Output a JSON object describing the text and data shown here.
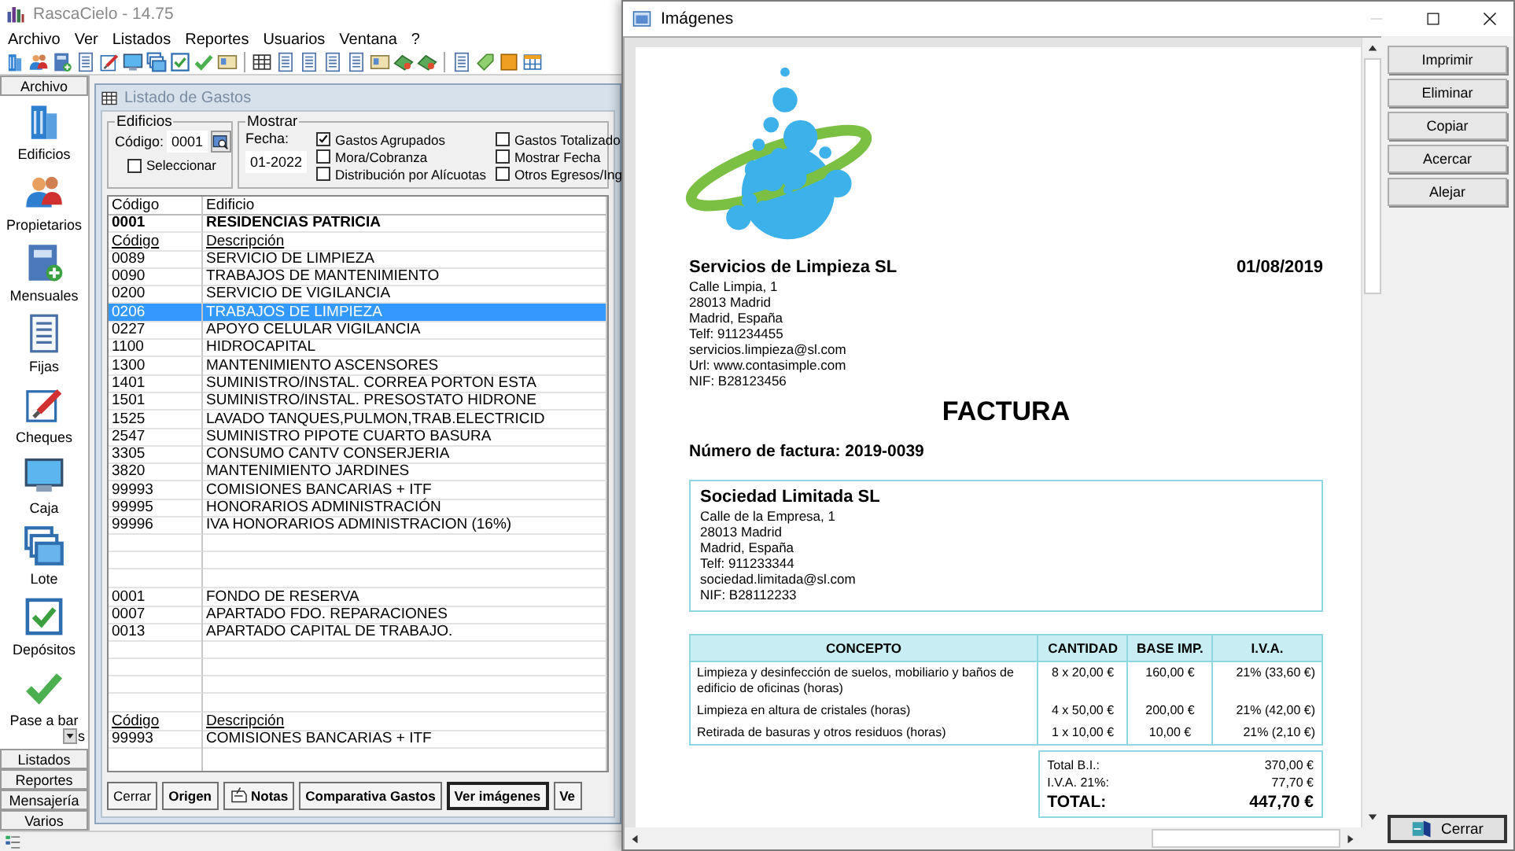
{
  "app_window": {
    "title": "RascaCielo - 14.75"
  },
  "menu": [
    "Archivo",
    "Ver",
    "Listados",
    "Reportes",
    "Usuarios",
    "Ventana",
    "?"
  ],
  "sidebar": {
    "header": "Archivo",
    "items": [
      {
        "label": "Edificios"
      },
      {
        "label": "Propietarios"
      },
      {
        "label": "Mensuales"
      },
      {
        "label": "Fijas"
      },
      {
        "label": "Cheques"
      },
      {
        "label": "Caja"
      },
      {
        "label": "Lote"
      },
      {
        "label": "Depósitos"
      },
      {
        "label": "Pase a bar",
        "dropdown": true,
        "label_tail": "s"
      }
    ],
    "sections": [
      "Listados",
      "Reportes",
      "Mensajería",
      "Varios"
    ]
  },
  "gastos_window": {
    "title": "Listado de Gastos",
    "edificios": {
      "legend": "Edificios",
      "codigo_label": "Código:",
      "codigo_value": "0001",
      "seleccionar": {
        "label": "Seleccionar",
        "checked": false
      }
    },
    "mostrar": {
      "legend": "Mostrar",
      "fecha_label": "Fecha:",
      "fecha_value": "01-2022",
      "options": [
        {
          "label": "Gastos Agrupados",
          "checked": true
        },
        {
          "label": "Mora/Cobranza",
          "checked": false
        },
        {
          "label": "Distribución por Alícuotas",
          "checked": false
        },
        {
          "label": "Gastos Totalizado",
          "checked": false
        },
        {
          "label": "Mostrar Fecha",
          "checked": false
        },
        {
          "label": "Otros Egresos/Ing",
          "checked": false
        }
      ]
    },
    "table": {
      "rows": [
        {
          "kind": "header",
          "cells": [
            "Código",
            "Edificio"
          ],
          "selected": false
        },
        {
          "kind": "building",
          "cells": [
            "0001",
            "RESIDENCIAS PATRICIA"
          ],
          "selected": false
        },
        {
          "kind": "subheader",
          "cells": [
            "Código",
            "Descripción"
          ],
          "selected": false
        },
        {
          "kind": "item",
          "cells": [
            "0089",
            "SERVICIO DE LIMPIEZA"
          ],
          "selected": false
        },
        {
          "kind": "item",
          "cells": [
            "0090",
            "TRABAJOS DE MANTENIMIENTO"
          ],
          "selected": false
        },
        {
          "kind": "item",
          "cells": [
            "0200",
            "SERVICIO DE VIGILANCIA"
          ],
          "selected": false
        },
        {
          "kind": "item",
          "cells": [
            "0206",
            "TRABAJOS DE LIMPIEZA"
          ],
          "selected": true
        },
        {
          "kind": "item",
          "cells": [
            "0227",
            "APOYO CELULAR VIGILANCIA"
          ],
          "selected": false
        },
        {
          "kind": "item",
          "cells": [
            "1100",
            "HIDROCAPITAL"
          ],
          "selected": false
        },
        {
          "kind": "item",
          "cells": [
            "1300",
            "MANTENIMIENTO ASCENSORES"
          ],
          "selected": false
        },
        {
          "kind": "item",
          "cells": [
            "1401",
            "SUMINISTRO/INSTAL. CORREA PORTON ESTA"
          ],
          "selected": false
        },
        {
          "kind": "item",
          "cells": [
            "1501",
            "SUMINISTRO/INSTAL. PRESOSTATO HIDRONE"
          ],
          "selected": false
        },
        {
          "kind": "item",
          "cells": [
            "1525",
            "LAVADO TANQUES,PULMON,TRAB.ELECTRICID"
          ],
          "selected": false
        },
        {
          "kind": "item",
          "cells": [
            "2547",
            "SUMINISTRO PIPOTE CUARTO BASURA"
          ],
          "selected": false
        },
        {
          "kind": "item",
          "cells": [
            "3305",
            "CONSUMO CANTV CONSERJERIA"
          ],
          "selected": false
        },
        {
          "kind": "item",
          "cells": [
            "3820",
            "MANTENIMIENTO JARDINES"
          ],
          "selected": false
        },
        {
          "kind": "item",
          "cells": [
            "99993",
            "COMISIONES BANCARIAS + ITF"
          ],
          "selected": false
        },
        {
          "kind": "item",
          "cells": [
            "99995",
            "HONORARIOS ADMINISTRACIÓN"
          ],
          "selected": false
        },
        {
          "kind": "item",
          "cells": [
            "99996",
            "IVA HONORARIOS ADMINISTRACION (16%)"
          ],
          "selected": false
        },
        {
          "kind": "blank"
        },
        {
          "kind": "blank"
        },
        {
          "kind": "blank"
        },
        {
          "kind": "item",
          "cells": [
            "0001",
            "FONDO DE RESERVA"
          ],
          "selected": false
        },
        {
          "kind": "item",
          "cells": [
            "0007",
            "APARTADO FDO. REPARACIONES"
          ],
          "selected": false
        },
        {
          "kind": "item",
          "cells": [
            "0013",
            "APARTADO  CAPITAL DE TRABAJO."
          ],
          "selected": false
        },
        {
          "kind": "blank"
        },
        {
          "kind": "blank"
        },
        {
          "kind": "blank"
        },
        {
          "kind": "blank"
        },
        {
          "kind": "subheader",
          "cells": [
            "Código",
            "Descripción"
          ],
          "selected": false
        },
        {
          "kind": "item",
          "cells": [
            "99993",
            "COMISIONES BANCARIAS + ITF"
          ],
          "selected": false
        }
      ]
    },
    "buttons": [
      {
        "label": "Cerrar",
        "kind": "plain",
        "focused": false
      },
      {
        "label": "Origen",
        "kind": "bold",
        "focused": false
      },
      {
        "label": "Notas",
        "kind": "note",
        "focused": false
      },
      {
        "label": "Comparativa Gastos",
        "kind": "bold",
        "focused": false
      },
      {
        "label": "Ver imágenes",
        "kind": "bold",
        "focused": true
      },
      {
        "label": "Ve",
        "kind": "bold",
        "focused": false
      }
    ]
  },
  "images_window": {
    "title": "Imágenes",
    "minimize_disabled": true,
    "buttons": [
      "Imprimir",
      "Eliminar",
      "Copiar",
      "Acercar",
      "Alejar"
    ],
    "close_button": "Cerrar",
    "invoice": {
      "issuer": {
        "name": "Servicios de Limpieza SL",
        "lines": [
          "Calle Limpia, 1",
          "28013 Madrid",
          "Madrid, España",
          "Telf:  911234455",
          "servicios.limpieza@sl.com",
          "Url: www.contasimple.com",
          "NIF: B28123456"
        ]
      },
      "date": "01/08/2019",
      "title": "FACTURA",
      "number": "Número de factura: 2019-0039",
      "client": {
        "name": "Sociedad Limitada SL",
        "lines": [
          "Calle de la Empresa, 1",
          "28013 Madrid",
          "Madrid, España",
          "Telf: 911233344",
          "sociedad.limitada@sl.com",
          "NIF: B28112233"
        ]
      },
      "table": {
        "columns": [
          "CONCEPTO",
          "CANTIDAD",
          "BASE IMP.",
          "I.V.A."
        ],
        "rows": [
          [
            "Limpieza y desinfección de suelos, mobiliario y baños de edificio de oficinas (horas)",
            "8 x 20,00 €",
            "160,00 €",
            "21% (33,60 €)"
          ],
          [
            "Limpieza en altura de cristales (horas)",
            "4 x 50,00 €",
            "200,00 €",
            "21% (42,00 €)"
          ],
          [
            "Retirada de basuras y otros residuos (horas)",
            "1 x 10,00 €",
            "10,00 €",
            "21% (2,10 €)"
          ]
        ]
      },
      "totals": [
        {
          "label": "Total B.I.:",
          "value": "370,00 €",
          "kind": "normal"
        },
        {
          "label": "I.V.A. 21%:",
          "value": "77,70 €",
          "kind": "normal"
        },
        {
          "label": "TOTAL:",
          "value": "447,70 €",
          "kind": "grand"
        }
      ]
    }
  }
}
